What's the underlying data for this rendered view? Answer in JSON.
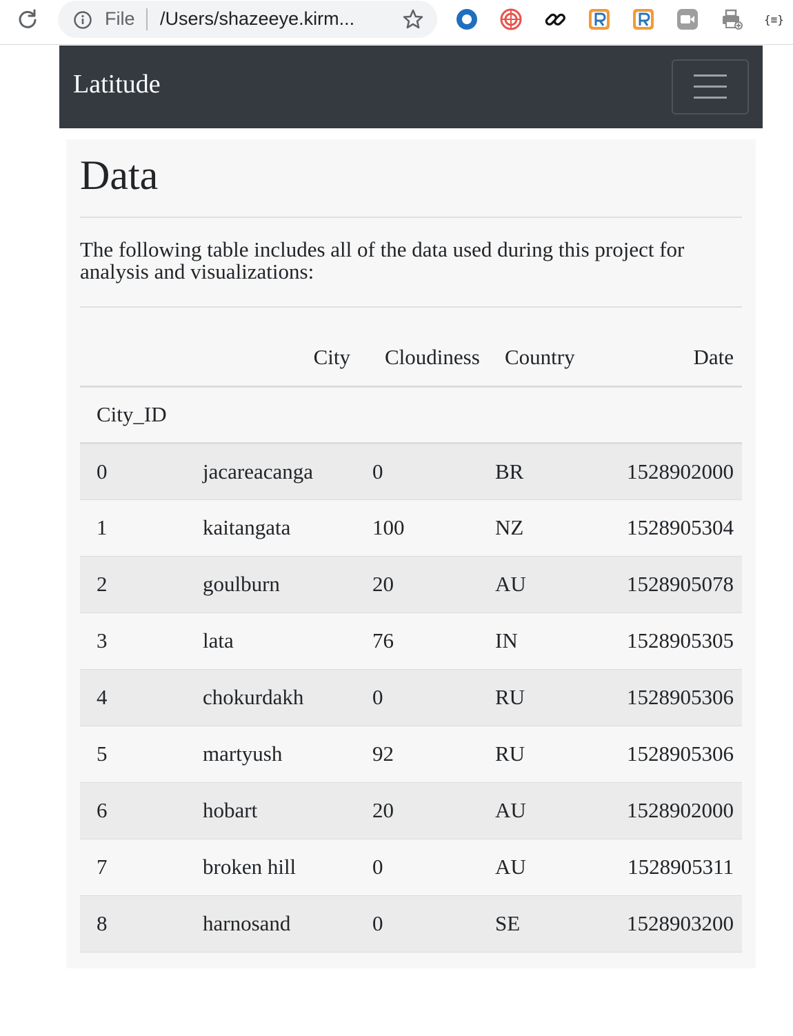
{
  "browser": {
    "file_label": "File",
    "url": "/Users/shazeeye.kirm...",
    "extensions": [
      "opera-ring-icon",
      "spiral-icon",
      "link-icon",
      "r-extension-icon",
      "r-extension-icon-2",
      "video-icon",
      "printer-icon",
      "json-icon"
    ],
    "json_icon_text": "{≡}"
  },
  "navbar": {
    "brand": "Latitude",
    "bg_color": "#343a40"
  },
  "main": {
    "title": "Data",
    "intro": "The following table includes all of the data used during this project for analysis and visualizations:"
  },
  "table": {
    "columns": [
      "City",
      "Cloudiness",
      "Country",
      "Date"
    ],
    "index_name": "City_ID",
    "rows": [
      {
        "id": "0",
        "city": "jacareacanga",
        "cloudiness": "0",
        "country": "BR",
        "date": "1528902000"
      },
      {
        "id": "1",
        "city": "kaitangata",
        "cloudiness": "100",
        "country": "NZ",
        "date": "1528905304"
      },
      {
        "id": "2",
        "city": "goulburn",
        "cloudiness": "20",
        "country": "AU",
        "date": "1528905078"
      },
      {
        "id": "3",
        "city": "lata",
        "cloudiness": "76",
        "country": "IN",
        "date": "1528905305"
      },
      {
        "id": "4",
        "city": "chokurdakh",
        "cloudiness": "0",
        "country": "RU",
        "date": "1528905306"
      },
      {
        "id": "5",
        "city": "martyush",
        "cloudiness": "92",
        "country": "RU",
        "date": "1528905306"
      },
      {
        "id": "6",
        "city": "hobart",
        "cloudiness": "20",
        "country": "AU",
        "date": "1528902000"
      },
      {
        "id": "7",
        "city": "broken hill",
        "cloudiness": "0",
        "country": "AU",
        "date": "1528905311"
      },
      {
        "id": "8",
        "city": "harnosand",
        "cloudiness": "0",
        "country": "SE",
        "date": "1528903200"
      }
    ]
  }
}
